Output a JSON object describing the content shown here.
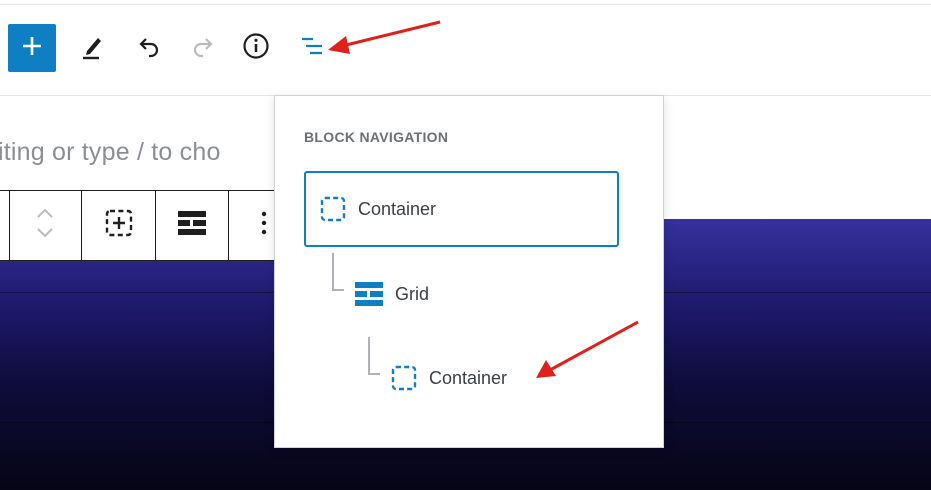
{
  "toolbar": {
    "add_label": "+",
    "colors": {
      "accent": "#0f7fc3",
      "icon": "#1e1e1e",
      "disabled": "#b8bcc0"
    },
    "icons": [
      "plus-icon",
      "pencil-icon",
      "undo-icon",
      "redo-icon",
      "info-icon",
      "list-view-icon"
    ]
  },
  "editor": {
    "placeholder": "iting or type / to cho"
  },
  "block_toolbar": {
    "icons": [
      "chevron-up-down-icon",
      "container-icon",
      "grid-icon",
      "more-vertical-icon"
    ]
  },
  "block_navigation": {
    "title": "BLOCK NAVIGATION",
    "items": [
      {
        "label": "Container",
        "icon": "container-icon",
        "selected": true
      },
      {
        "label": "Grid",
        "icon": "grid-icon",
        "selected": false
      },
      {
        "label": "Container",
        "icon": "container-icon",
        "selected": false
      }
    ]
  },
  "annotations": {
    "arrow_color": "#e0201b"
  }
}
